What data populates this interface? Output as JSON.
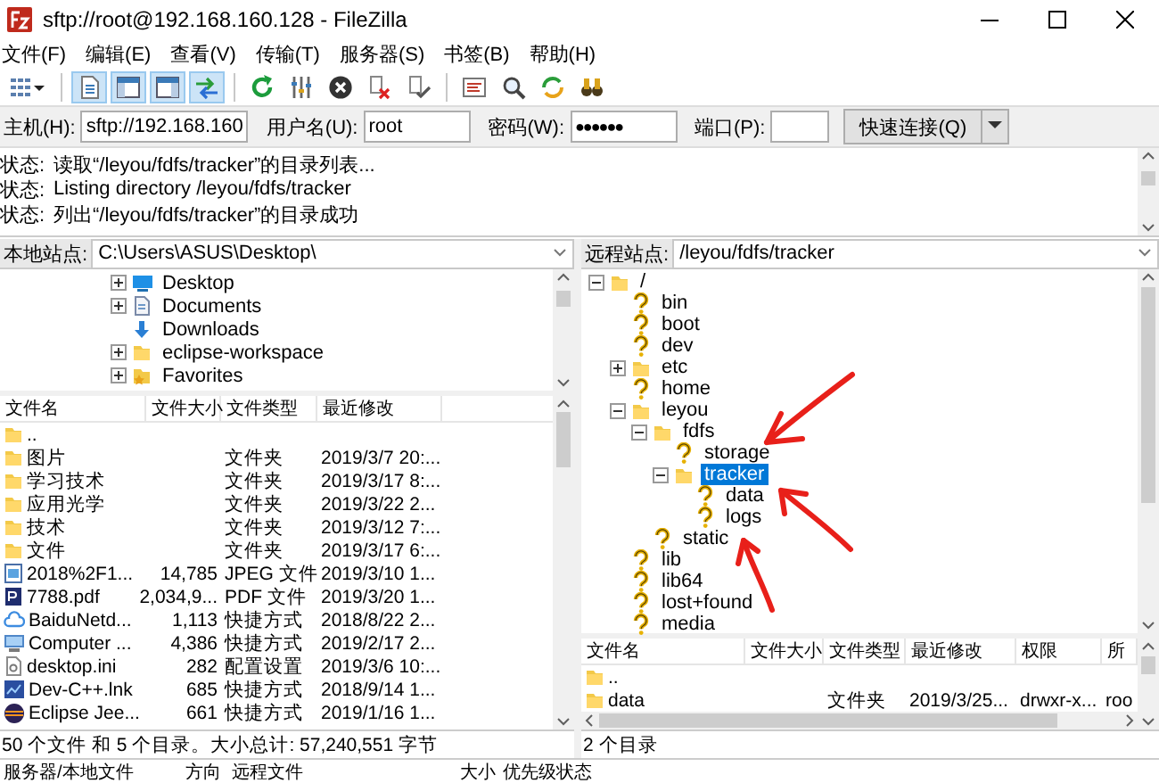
{
  "window": {
    "title": "sftp://root@192.168.160.128 - FileZilla"
  },
  "menu": [
    "文件(F)",
    "编辑(E)",
    "查看(V)",
    "传输(T)",
    "服务器(S)",
    "书签(B)",
    "帮助(H)"
  ],
  "toolbar": [
    {
      "pressed": false
    },
    {
      "pressed": true
    },
    {
      "pressed": true
    },
    {
      "pressed": true
    },
    {
      "pressed": true
    },
    {
      "pressed": false
    },
    {
      "pressed": false
    },
    {
      "pressed": false
    },
    {
      "pressed": false
    },
    {
      "pressed": false
    },
    {
      "pressed": false
    },
    {
      "pressed": false
    },
    {
      "pressed": false
    },
    {
      "pressed": false
    }
  ],
  "quickconnect": {
    "fields": [
      {
        "label": "主机(H):",
        "value": "sftp://192.168.160"
      },
      {
        "label": "用户名(U):",
        "value": "root"
      },
      {
        "label": "密码(W):",
        "value": "●●●●●●"
      },
      {
        "label": "端口(P):"
      }
    ],
    "button": "快速连接(Q)"
  },
  "log": [
    {
      "label": "状态:",
      "message": "读取“/leyou/fdfs/tracker”的目录列表..."
    },
    {
      "label": "状态:",
      "message": "Listing directory /leyou/fdfs/tracker"
    },
    {
      "label": "状态:",
      "message": "列出“/leyou/fdfs/tracker”的目录成功"
    }
  ],
  "local_site": {
    "label": "本地站点:",
    "path": "C:\\Users\\ASUS\\Desktop\\"
  },
  "local_tree": [
    {
      "label": "Desktop",
      "kind": "desktop",
      "expanded": false,
      "selected": false
    },
    {
      "label": "Documents",
      "kind": "documents",
      "expanded": false,
      "selected": false
    },
    {
      "label": "Downloads",
      "kind": "downloads",
      "selected": false
    },
    {
      "label": "eclipse-workspace",
      "kind": "folder",
      "expanded": false,
      "selected": false
    },
    {
      "label": "Favorites",
      "kind": "favorites",
      "expanded": false,
      "selected": false
    }
  ],
  "local_list": {
    "columns": [
      "文件名",
      "文件大小",
      "文件类型",
      "最近修改"
    ],
    "rows": [
      {
        "kind": "folder",
        "name": ".."
      },
      {
        "kind": "folder",
        "name": "图片",
        "type": "文件夹",
        "modified": "2019/3/7 20:..."
      },
      {
        "kind": "folder",
        "name": "学习技术",
        "type": "文件夹",
        "modified": "2019/3/17 8:..."
      },
      {
        "kind": "folder",
        "name": "应用光学",
        "type": "文件夹",
        "modified": "2019/3/22 2..."
      },
      {
        "kind": "folder",
        "name": "技术",
        "type": "文件夹",
        "modified": "2019/3/12 7:..."
      },
      {
        "kind": "folder",
        "name": "文件",
        "type": "文件夹",
        "modified": "2019/3/17 6:..."
      },
      {
        "kind": "image",
        "name": "2018%2F1...",
        "size": "14,785",
        "type": "JPEG 文件",
        "modified": "2019/3/10 1..."
      },
      {
        "kind": "pdf",
        "name": "7788.pdf",
        "size": "2,034,9...",
        "type": "PDF 文件",
        "modified": "2019/3/20 1..."
      },
      {
        "kind": "cloud",
        "name": "BaiduNetd...",
        "size": "1,113",
        "type": "快捷方式",
        "modified": "2018/8/22 2..."
      },
      {
        "kind": "computer",
        "name": "Computer ...",
        "size": "4,386",
        "type": "快捷方式",
        "modified": "2019/2/17 2..."
      },
      {
        "kind": "text",
        "name": "desktop.ini",
        "size": "282",
        "type": "配置设置",
        "modified": "2019/3/6 10:..."
      },
      {
        "kind": "app",
        "name": "Dev-C++.lnk",
        "size": "685",
        "type": "快捷方式",
        "modified": "2018/9/14 1..."
      },
      {
        "kind": "eclipse",
        "name": "Eclipse Jee...",
        "size": "661",
        "type": "快捷方式",
        "modified": "2019/1/16 1..."
      }
    ],
    "status": "50 个文件 和 5 个目录。大小总计: 57,240,551 字节"
  },
  "remote_site": {
    "label": "远程站点:",
    "path": "/leyou/fdfs/tracker"
  },
  "remote_tree": [
    {
      "label": "/",
      "kind": "folder",
      "expanded": true,
      "selected": false,
      "children": [
        {
          "label": "bin",
          "kind": "unknown",
          "selected": false
        },
        {
          "label": "boot",
          "kind": "unknown",
          "selected": false
        },
        {
          "label": "dev",
          "kind": "unknown",
          "selected": false
        },
        {
          "label": "etc",
          "kind": "folder",
          "expanded": false,
          "selected": false
        },
        {
          "label": "home",
          "kind": "unknown",
          "selected": false
        },
        {
          "label": "leyou",
          "kind": "folder",
          "expanded": true,
          "selected": false,
          "children": [
            {
              "label": "fdfs",
              "kind": "folder",
              "expanded": true,
              "selected": false,
              "children": [
                {
                  "label": "storage",
                  "kind": "unknown",
                  "selected": false
                },
                {
                  "label": "tracker",
                  "kind": "folder",
                  "expanded": true,
                  "selected": true,
                  "children": [
                    {
                      "label": "data",
                      "kind": "unknown",
                      "selected": false
                    },
                    {
                      "label": "logs",
                      "kind": "unknown",
                      "selected": false
                    }
                  ]
                }
              ]
            },
            {
              "label": "static",
              "kind": "unknown",
              "selected": false
            }
          ]
        },
        {
          "label": "lib",
          "kind": "unknown",
          "selected": false
        },
        {
          "label": "lib64",
          "kind": "unknown",
          "selected": false
        },
        {
          "label": "lost+found",
          "kind": "unknown",
          "selected": false
        },
        {
          "label": "media",
          "kind": "unknown",
          "selected": false
        }
      ]
    }
  ],
  "remote_list": {
    "columns": [
      "文件名",
      "文件大小",
      "文件类型",
      "最近修改",
      "权限",
      "所"
    ],
    "rows": [
      {
        "kind": "folder",
        "name": ".."
      },
      {
        "kind": "folder",
        "name": "data",
        "type": "文件夹",
        "modified": "2019/3/25...",
        "permissions": "drwxr-x...",
        "owner": "roo"
      }
    ],
    "status": "2 个目录"
  },
  "queue": {
    "columns": [
      "服务器/本地文件",
      "方向",
      "远程文件",
      "大小",
      "优先级",
      "状态"
    ]
  },
  "annotations": [
    {
      "kind": "arrow"
    },
    {
      "kind": "arrow"
    },
    {
      "kind": "arrow"
    }
  ]
}
